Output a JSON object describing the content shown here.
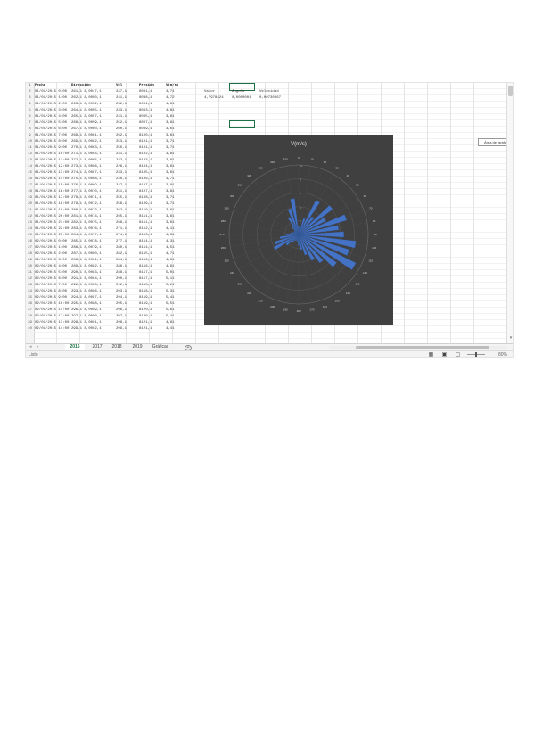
{
  "sheet": {
    "header": [
      "Fecha",
      "Dirección",
      "Vel",
      "Presión",
      "V(m/s)"
    ],
    "rows": [
      [
        "01/01/2015 0:00",
        "261,1 8,0047,1",
        "247,1",
        "8081,1",
        "4,71"
      ],
      [
        "01/01/2015 1:00",
        "262,1 8,0050,1",
        "241,1",
        "8088,1",
        "4,72"
      ],
      [
        "01/01/2015 2:00",
        "263,1 8,0052,1",
        "232,1",
        "8091,1",
        "4,81"
      ],
      [
        "01/01/2015 3:00",
        "264,1 8,0055,1",
        "233,1",
        "8093,1",
        "4,81"
      ],
      [
        "01/01/2015 4:00",
        "265,1 8,0057,1",
        "241,1",
        "8095,1",
        "3,61"
      ],
      [
        "01/01/2015 5:00",
        "266,1 8,0059,1",
        "252,1",
        "8097,1",
        "3,81"
      ],
      [
        "01/01/2015 6:00",
        "267,1 8,0060,1",
        "260,1",
        "8099,1",
        "3,61"
      ],
      [
        "01/01/2015 7:00",
        "268,1 8,0061,1",
        "262,1",
        "8100,1",
        "3,61"
      ],
      [
        "01/01/2015 8:00",
        "269,1 8,0062,1",
        "253,1",
        "8101,1",
        "3,71"
      ],
      [
        "01/01/2015 9:00",
        "270,1 8,0063,1",
        "250,1",
        "8101,1",
        "3,71"
      ],
      [
        "01/01/2015 10:00",
        "271,1 8,0064,1",
        "231,1",
        "8102,1",
        "3,81"
      ],
      [
        "01/01/2015 11:00",
        "272,1 8,0065,1",
        "222,1",
        "8103,1",
        "3,61"
      ],
      [
        "01/01/2015 12:00",
        "273,1 8,0066,1",
        "226,1",
        "8104,1",
        "3,61"
      ],
      [
        "01/01/2015 13:00",
        "274,1 8,0067,1",
        "233,1",
        "8105,1",
        "3,61"
      ],
      [
        "01/01/2015 14:00",
        "275,1 8,0068,1",
        "240,1",
        "8106,1",
        "3,71"
      ],
      [
        "01/01/2015 15:00",
        "276,1 8,0069,1",
        "247,1",
        "8107,1",
        "3,81"
      ],
      [
        "01/01/2015 16:00",
        "277,1 8,0070,1",
        "251,1",
        "8107,1",
        "3,81"
      ],
      [
        "01/01/2015 17:00",
        "278,1 8,0071,1",
        "255,1",
        "8108,1",
        "3,71"
      ],
      [
        "01/01/2015 18:00",
        "279,1 8,0072,1",
        "258,1",
        "8109,1",
        "3,71"
      ],
      [
        "01/01/2015 19:00",
        "280,1 8,0073,1",
        "262,1",
        "8110,1",
        "3,61"
      ],
      [
        "01/01/2015 20:00",
        "281,1 8,0074,1",
        "265,1",
        "8111,1",
        "3,61"
      ],
      [
        "01/01/2015 21:00",
        "282,1 8,0075,1",
        "268,1",
        "8111,1",
        "3,61"
      ],
      [
        "01/01/2015 22:00",
        "283,1 8,0076,1",
        "271,1",
        "8112,1",
        "4,11"
      ],
      [
        "01/01/2015 23:00",
        "284,1 8,0077,1",
        "274,1",
        "8113,1",
        "4,31"
      ],
      [
        "02/01/2015 0:00",
        "285,1 8,0078,1",
        "277,1",
        "8114,1",
        "4,31"
      ],
      [
        "02/01/2015 1:00",
        "286,1 8,0079,1",
        "280,1",
        "8114,1",
        "4,51"
      ],
      [
        "02/01/2015 2:00",
        "287,1 8,0080,1",
        "282,1",
        "8115,1",
        "4,71"
      ],
      [
        "02/01/2015 3:00",
        "288,1 8,0081,1",
        "284,1",
        "8116,1",
        "4,81"
      ],
      [
        "02/01/2015 4:00",
        "289,1 8,0082,1",
        "286,1",
        "8116,1",
        "4,91"
      ],
      [
        "02/01/2015 5:00",
        "290,1 8,0083,1",
        "288,1",
        "8117,1",
        "5,01"
      ],
      [
        "02/01/2015 6:00",
        "291,1 8,0084,1",
        "290,1",
        "8117,1",
        "5,11"
      ],
      [
        "02/01/2015 7:00",
        "292,1 8,0085,1",
        "292,1",
        "8118,1",
        "5,21"
      ],
      [
        "02/01/2015 8:00",
        "293,1 8,0086,1",
        "293,1",
        "8118,1",
        "5,31"
      ],
      [
        "02/01/2015 9:00",
        "294,1 8,0087,1",
        "294,1",
        "8119,1",
        "5,41"
      ],
      [
        "02/01/2015 10:00",
        "295,1 8,0088,1",
        "295,1",
        "8119,1",
        "5,51"
      ],
      [
        "02/01/2015 11:00",
        "296,1 8,0089,1",
        "296,1",
        "8120,1",
        "5,61"
      ],
      [
        "02/01/2015 12:00",
        "297,1 8,0090,1",
        "297,1",
        "8120,1",
        "5,41"
      ],
      [
        "02/01/2015 13:00",
        "298,1 8,0091,1",
        "298,1",
        "8121,1",
        "4,61"
      ],
      [
        "02/01/2015 14:00",
        "299,1 8,0092,1",
        "299,1",
        "8121,1",
        "4,41"
      ]
    ],
    "side_headers": [
      "Valor",
      "Ángulo",
      "Velocidad"
    ],
    "side_values": [
      "4,7978424",
      "0,0000001",
      "0,00730067"
    ]
  },
  "chart": {
    "title": "V(m/s)",
    "background": "#404040",
    "bar_color": "#4472c4",
    "radial_ticks": [
      "0",
      "2",
      "4",
      "6",
      "8",
      "10"
    ],
    "angle_labels": [
      "0",
      "10",
      "20",
      "30",
      "40",
      "50",
      "60",
      "70",
      "80",
      "90",
      "100",
      "110",
      "120",
      "130",
      "140",
      "150",
      "160",
      "170",
      "180",
      "190",
      "200",
      "210",
      "220",
      "230",
      "240",
      "250",
      "260",
      "270",
      "280",
      "290",
      "300",
      "310",
      "320",
      "330",
      "340",
      "350"
    ]
  },
  "chart_data": {
    "type": "bar",
    "title": "V(m/s)",
    "categories": [
      "0",
      "10",
      "20",
      "30",
      "40",
      "50",
      "60",
      "70",
      "80",
      "90",
      "100",
      "110",
      "120",
      "130",
      "140",
      "150",
      "160",
      "170",
      "180",
      "190",
      "200",
      "210",
      "220",
      "230",
      "240",
      "250",
      "260",
      "270",
      "280",
      "290",
      "300",
      "310",
      "320",
      "330",
      "340",
      "350"
    ],
    "values": [
      1.2,
      0.8,
      2.4,
      5.5,
      3.2,
      6.1,
      4.4,
      7.2,
      5.8,
      6.5,
      8.3,
      7.6,
      9.2,
      6.8,
      5.1,
      4.2,
      3.1,
      2.2,
      1.6,
      1.1,
      0.9,
      1.0,
      1.4,
      2.3,
      4.0,
      3.6,
      2.7,
      1.8,
      1.2,
      0.9,
      0.7,
      0.8,
      1.5,
      2.8,
      3.9,
      5.2
    ],
    "ylim": [
      0,
      10
    ],
    "grid": true,
    "series": [
      {
        "name": "V(m/s)",
        "values": [
          1.2,
          0.8,
          2.4,
          5.5,
          3.2,
          6.1,
          4.4,
          7.2,
          5.8,
          6.5,
          8.3,
          7.6,
          9.2,
          6.8,
          5.1,
          4.2,
          3.1,
          2.2,
          1.6,
          1.1,
          0.9,
          1.0,
          1.4,
          2.3,
          4.0,
          3.6,
          2.7,
          1.8,
          1.2,
          0.9,
          0.7,
          0.8,
          1.5,
          2.8,
          3.9,
          5.2
        ]
      }
    ]
  },
  "tabs": [
    {
      "label": "2016",
      "active": true
    },
    {
      "label": "2017",
      "active": false
    },
    {
      "label": "2018",
      "active": false
    },
    {
      "label": "2019",
      "active": false
    },
    {
      "label": "Gráficas",
      "active": false
    }
  ],
  "tooltip": "Área del gráfico",
  "status": {
    "text": "Listo",
    "zoom": "80%"
  }
}
